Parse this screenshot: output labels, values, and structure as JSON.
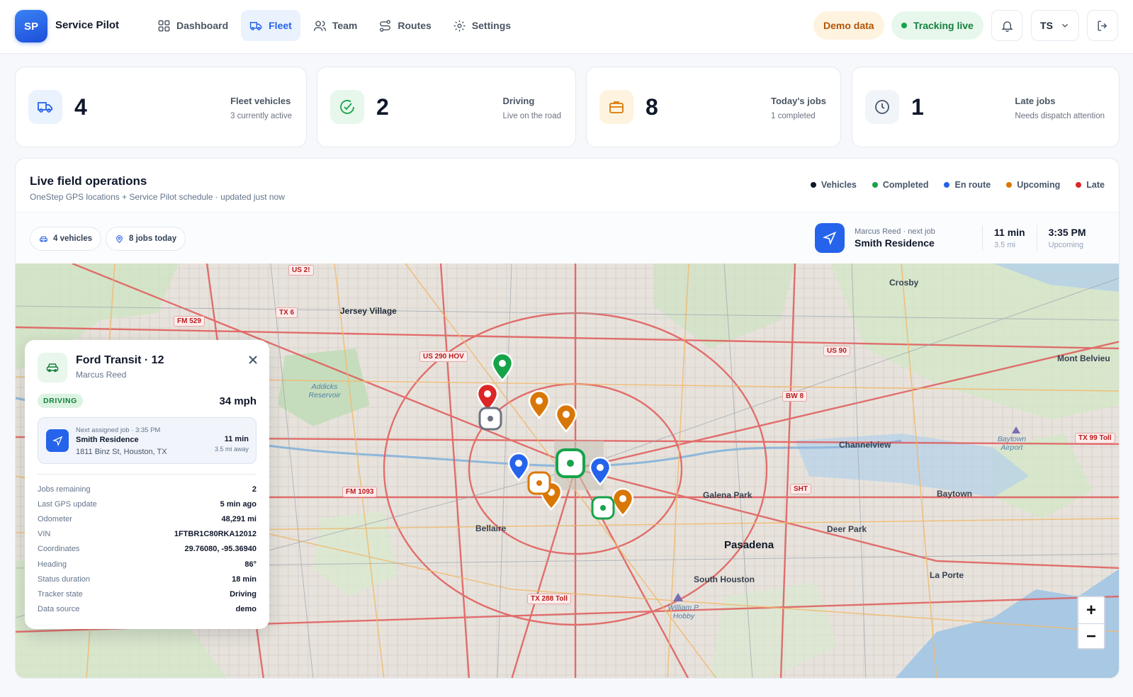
{
  "header": {
    "logo": "SP",
    "brand": "Service Pilot",
    "nav": [
      {
        "label": "Dashboard",
        "icon": "grid-icon"
      },
      {
        "label": "Fleet",
        "icon": "truck-icon",
        "active": true
      },
      {
        "label": "Team",
        "icon": "users-icon"
      },
      {
        "label": "Routes",
        "icon": "route-icon"
      },
      {
        "label": "Settings",
        "icon": "gear-icon"
      }
    ],
    "demo_pill": "Demo data",
    "live_pill": "Tracking live",
    "user_initials": "TS"
  },
  "stats": [
    {
      "value": "4",
      "title": "Fleet vehicles",
      "sub": "3 currently active",
      "icon": "truck-icon",
      "color": "#2563eb",
      "bg": "#eaf2fe"
    },
    {
      "value": "2",
      "title": "Driving",
      "sub": "Live on the road",
      "icon": "check-circle-icon",
      "color": "#16a34a",
      "bg": "#e7f7ec"
    },
    {
      "value": "8",
      "title": "Today's jobs",
      "sub": "1 completed",
      "icon": "briefcase-icon",
      "color": "#d97706",
      "bg": "#fdf3df"
    },
    {
      "value": "1",
      "title": "Late jobs",
      "sub": "Needs dispatch attention",
      "icon": "clock-icon",
      "color": "#475569",
      "bg": "#f1f5f9"
    }
  ],
  "panel": {
    "title": "Live field operations",
    "subtitle": "OneStep GPS locations + Service Pilot schedule · updated just now",
    "legend": [
      {
        "label": "Vehicles",
        "color": "#111827"
      },
      {
        "label": "Completed",
        "color": "#16a34a"
      },
      {
        "label": "En route",
        "color": "#2563eb"
      },
      {
        "label": "Upcoming",
        "color": "#d97706"
      },
      {
        "label": "Late",
        "color": "#dc2626"
      }
    ],
    "chips": {
      "vehicles": "4 vehicles",
      "jobs": "8 jobs today"
    },
    "next_job": {
      "label": "Marcus Reed · next job",
      "name": "Smith Residence",
      "eta": "11 min",
      "distance": "3.5 mi",
      "time": "3:35 PM",
      "status": "Upcoming"
    }
  },
  "map": {
    "labels": {
      "jersey_village": "Jersey Village",
      "crosby": "Crosby",
      "mont_belvieu": "Mont Belvieu",
      "channelview": "Channelview",
      "galena_park": "Galena Park",
      "baytown": "Baytown",
      "deer_park": "Deer Park",
      "pasadena": "Pasadena",
      "south_houston": "South Houston",
      "la_porte": "La Porte",
      "bellaire": "Bellaire",
      "addicks": "Addicks Reservoir",
      "hobby": "William P. Hobby",
      "baytown_airport": "Baytown Airport"
    },
    "shields": {
      "us290": "US 290 HOV",
      "us29": "US 2!",
      "tx6": "TX 6",
      "fm529": "FM 529",
      "us90": "US 90",
      "bw8": "BW 8",
      "tx99": "TX 99 Toll",
      "fm1093": "FM 1093",
      "sht": "SHT",
      "tx288": "TX 288 Toll"
    },
    "zoom_in": "+",
    "zoom_out": "−"
  },
  "vehicle": {
    "name": "Ford Transit · 12",
    "driver": "Marcus Reed",
    "status": "DRIVING",
    "speed": "34 mph",
    "next_job_label": "Next assigned job · 3:35 PM",
    "next_job_name": "Smith Residence",
    "next_job_address": "1811 Binz St, Houston, TX",
    "eta": "11 min",
    "distance": "3.5 mi away",
    "details": [
      {
        "k": "Jobs remaining",
        "v": "2"
      },
      {
        "k": "Last GPS update",
        "v": "5 min ago"
      },
      {
        "k": "Odometer",
        "v": "48,291 mi"
      },
      {
        "k": "VIN",
        "v": "1FTBR1C80RKA12012"
      },
      {
        "k": "Coordinates",
        "v": "29.76080, -95.36940"
      },
      {
        "k": "Heading",
        "v": "86°"
      },
      {
        "k": "Status duration",
        "v": "18 min"
      },
      {
        "k": "Tracker state",
        "v": "Driving"
      },
      {
        "k": "Data source",
        "v": "demo"
      }
    ]
  }
}
